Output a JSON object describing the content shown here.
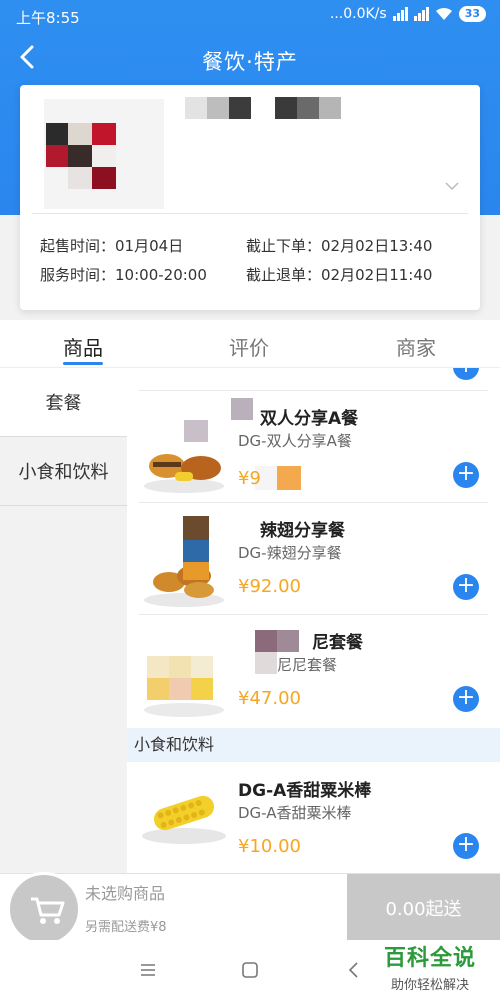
{
  "status": {
    "time": "上午8:55",
    "network": "...0.0K/s",
    "battery": "33"
  },
  "header": {
    "title": "餐饮·特产"
  },
  "card": {
    "start_sale_label": "起售时间：",
    "start_sale_value": "01月04日",
    "order_deadline_label": "截止下单：",
    "order_deadline_value": "02月02日13:40",
    "service_time_label": "服务时间：",
    "service_time_value": "10:00-20:00",
    "refund_deadline_label": "截止退单：",
    "refund_deadline_value": "02月02日11:40"
  },
  "tabs": [
    {
      "label": "商品",
      "active": true
    },
    {
      "label": "评价",
      "active": false
    },
    {
      "label": "商家",
      "active": false
    }
  ],
  "categories": [
    {
      "label": "套餐",
      "active": true
    },
    {
      "label": "小食和饮料",
      "active": false
    }
  ],
  "products": [
    {
      "name": "双人分享A餐",
      "desc": "DG-双人分享A餐",
      "price": "¥9"
    },
    {
      "name": "辣翅分享餐",
      "desc": "DG-辣翅分享餐",
      "price": "¥92.00"
    },
    {
      "name": "尼套餐",
      "desc": "尼尼套餐",
      "price": "¥47.00"
    }
  ],
  "section_snacks": "小食和饮料",
  "snack": {
    "name": "DG-A香甜粟米棒",
    "desc": "DG-A香甜粟米棒",
    "price": "¥10.00"
  },
  "cart": {
    "empty_label": "未选购商品",
    "delivery_fee": "另需配送费¥8",
    "checkout_label": "0.00起送"
  },
  "watermark": {
    "top": "百科全说",
    "bottom": "助你轻松解决"
  },
  "colors": {
    "accent": "#2a86ee",
    "price": "#f5a623",
    "disabled": "#c8c8c8"
  }
}
